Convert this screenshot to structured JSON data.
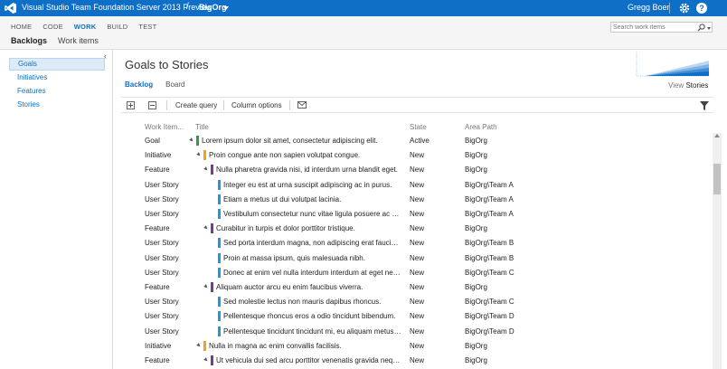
{
  "topbar": {
    "product": "Visual Studio Team Foundation Server 2013 Preview",
    "separator": "/",
    "org": "BigOrg",
    "user": "Gregg Boer",
    "help": "?"
  },
  "nav": {
    "hubs": [
      "HOME",
      "CODE",
      "WORK",
      "BUILD",
      "TEST"
    ],
    "active_hub": "WORK",
    "subtabs": [
      "Backlogs",
      "Work items"
    ],
    "active_subtab": "Backlogs",
    "search_placeholder": "Search work items"
  },
  "sidebar": {
    "collapse": "‹",
    "items": [
      "Goals",
      "Initiatives",
      "Features",
      "Stories"
    ],
    "selected": "Goals"
  },
  "main": {
    "title": "Goals to Stories",
    "pivots": [
      "Backlog",
      "Board"
    ],
    "active_pivot": "Backlog",
    "view_label": "View",
    "view_value": "Stories",
    "toolbar": {
      "create_query": "Create query",
      "column_options": "Column options"
    },
    "columns": {
      "type": "Work Item...",
      "title": "Title",
      "state": "State",
      "area": "Area Path"
    },
    "rows": [
      {
        "type": "Goal",
        "level": 0,
        "expander": true,
        "color": "#339947",
        "title": "Lorem ipsum dolor sit amet, consectetur adipiscing elit.",
        "state": "Active",
        "area": "BigOrg"
      },
      {
        "type": "Initiative",
        "level": 1,
        "expander": true,
        "color": "#f2a31b",
        "title": "Proin congue ante non sapien volutpat congue.",
        "state": "New",
        "area": "BigOrg"
      },
      {
        "type": "Feature",
        "level": 2,
        "expander": true,
        "color": "#773b93",
        "title": "Nulla pharetra gravida nisi, id interdum urna blandit eget.",
        "state": "New",
        "area": "BigOrg"
      },
      {
        "type": "User Story",
        "level": 3,
        "expander": false,
        "color": "#1f9ad6",
        "title": "Integer eu est at urna suscipit adipiscing ac in purus.",
        "state": "New",
        "area": "BigOrg\\Team A"
      },
      {
        "type": "User Story",
        "level": 3,
        "expander": false,
        "color": "#1f9ad6",
        "title": "Etiam a metus ut dui volutpat lacinia.",
        "state": "New",
        "area": "BigOrg\\Team A"
      },
      {
        "type": "User Story",
        "level": 3,
        "expander": false,
        "color": "#1f9ad6",
        "title": "Vestibulum consectetur nunc vitae ligula posuere ac ulla...",
        "state": "New",
        "area": "BigOrg\\Team A"
      },
      {
        "type": "Feature",
        "level": 2,
        "expander": true,
        "color": "#773b93",
        "title": "Curabitur in turpis et dolor porttitor tristique.",
        "state": "New",
        "area": "BigOrg"
      },
      {
        "type": "User Story",
        "level": 3,
        "expander": false,
        "color": "#1f9ad6",
        "title": "Sed porta interdum magna, non adipiscing erat faucibus v...",
        "state": "New",
        "area": "BigOrg\\Team B"
      },
      {
        "type": "User Story",
        "level": 3,
        "expander": false,
        "color": "#1f9ad6",
        "title": "Proin at massa ipsum, quis malesuada nibh.",
        "state": "New",
        "area": "BigOrg\\Team B"
      },
      {
        "type": "User Story",
        "level": 3,
        "expander": false,
        "color": "#1f9ad6",
        "title": "Donec at enim vel nulla interdum interdum at eget neque.",
        "state": "New",
        "area": "BigOrg\\Team C"
      },
      {
        "type": "Feature",
        "level": 2,
        "expander": true,
        "color": "#773b93",
        "title": "Aliquam auctor arcu eu enim faucibus viverra.",
        "state": "New",
        "area": "BigOrg"
      },
      {
        "type": "User Story",
        "level": 3,
        "expander": false,
        "color": "#1f9ad6",
        "title": "Sed molestie lectus non mauris dapibus rhoncus.",
        "state": "New",
        "area": "BigOrg\\Team C"
      },
      {
        "type": "User Story",
        "level": 3,
        "expander": false,
        "color": "#1f9ad6",
        "title": "Pellentesque rhoncus eros a odio tincidunt bibendum.",
        "state": "New",
        "area": "BigOrg\\Team D"
      },
      {
        "type": "User Story",
        "level": 3,
        "expander": false,
        "color": "#1f9ad6",
        "title": "Pellentesque tincidunt tincidunt mi, eu aliquam metus fau...",
        "state": "New",
        "area": "BigOrg\\Team D"
      },
      {
        "type": "Initiative",
        "level": 1,
        "expander": true,
        "color": "#f2a31b",
        "title": "Nulla in magna ac enim convallis facilisis.",
        "state": "New",
        "area": "BigOrg"
      },
      {
        "type": "Feature",
        "level": 2,
        "expander": true,
        "color": "#773b93",
        "title": "Ut vehicula dui sed arcu porttitor venenatis gravida neque.",
        "state": "New",
        "area": "BigOrg"
      }
    ]
  },
  "colors": {
    "brand": "#0f6fc6",
    "goal": "#339947",
    "initiative": "#f2a31b",
    "feature": "#773b93",
    "story": "#1f9ad6"
  }
}
